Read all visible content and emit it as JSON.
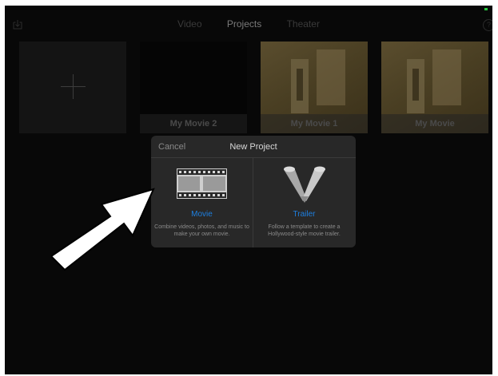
{
  "topbar": {
    "tabs": [
      {
        "label": "Video",
        "active": false
      },
      {
        "label": "Projects",
        "active": true
      },
      {
        "label": "Theater",
        "active": false
      }
    ],
    "import_icon": "import-icon",
    "help_label": "?",
    "battery_color": "#27c93f"
  },
  "projects": [
    {
      "title": "My Movie 2"
    },
    {
      "title": "My Movie 1"
    },
    {
      "title": "My Movie"
    }
  ],
  "dialog": {
    "cancel_label": "Cancel",
    "title": "New Project",
    "options": [
      {
        "label": "Movie",
        "description": "Combine videos, photos, and music to make your own movie.",
        "icon": "film-strip-icon"
      },
      {
        "label": "Trailer",
        "description": "Follow a template to create a Hollywood-style movie trailer.",
        "icon": "spotlight-icon"
      }
    ]
  },
  "colors": {
    "accent": "#1d7fe0",
    "background": "#080808",
    "dialog": "#282828",
    "annotation_arrow": "#ffffff"
  }
}
